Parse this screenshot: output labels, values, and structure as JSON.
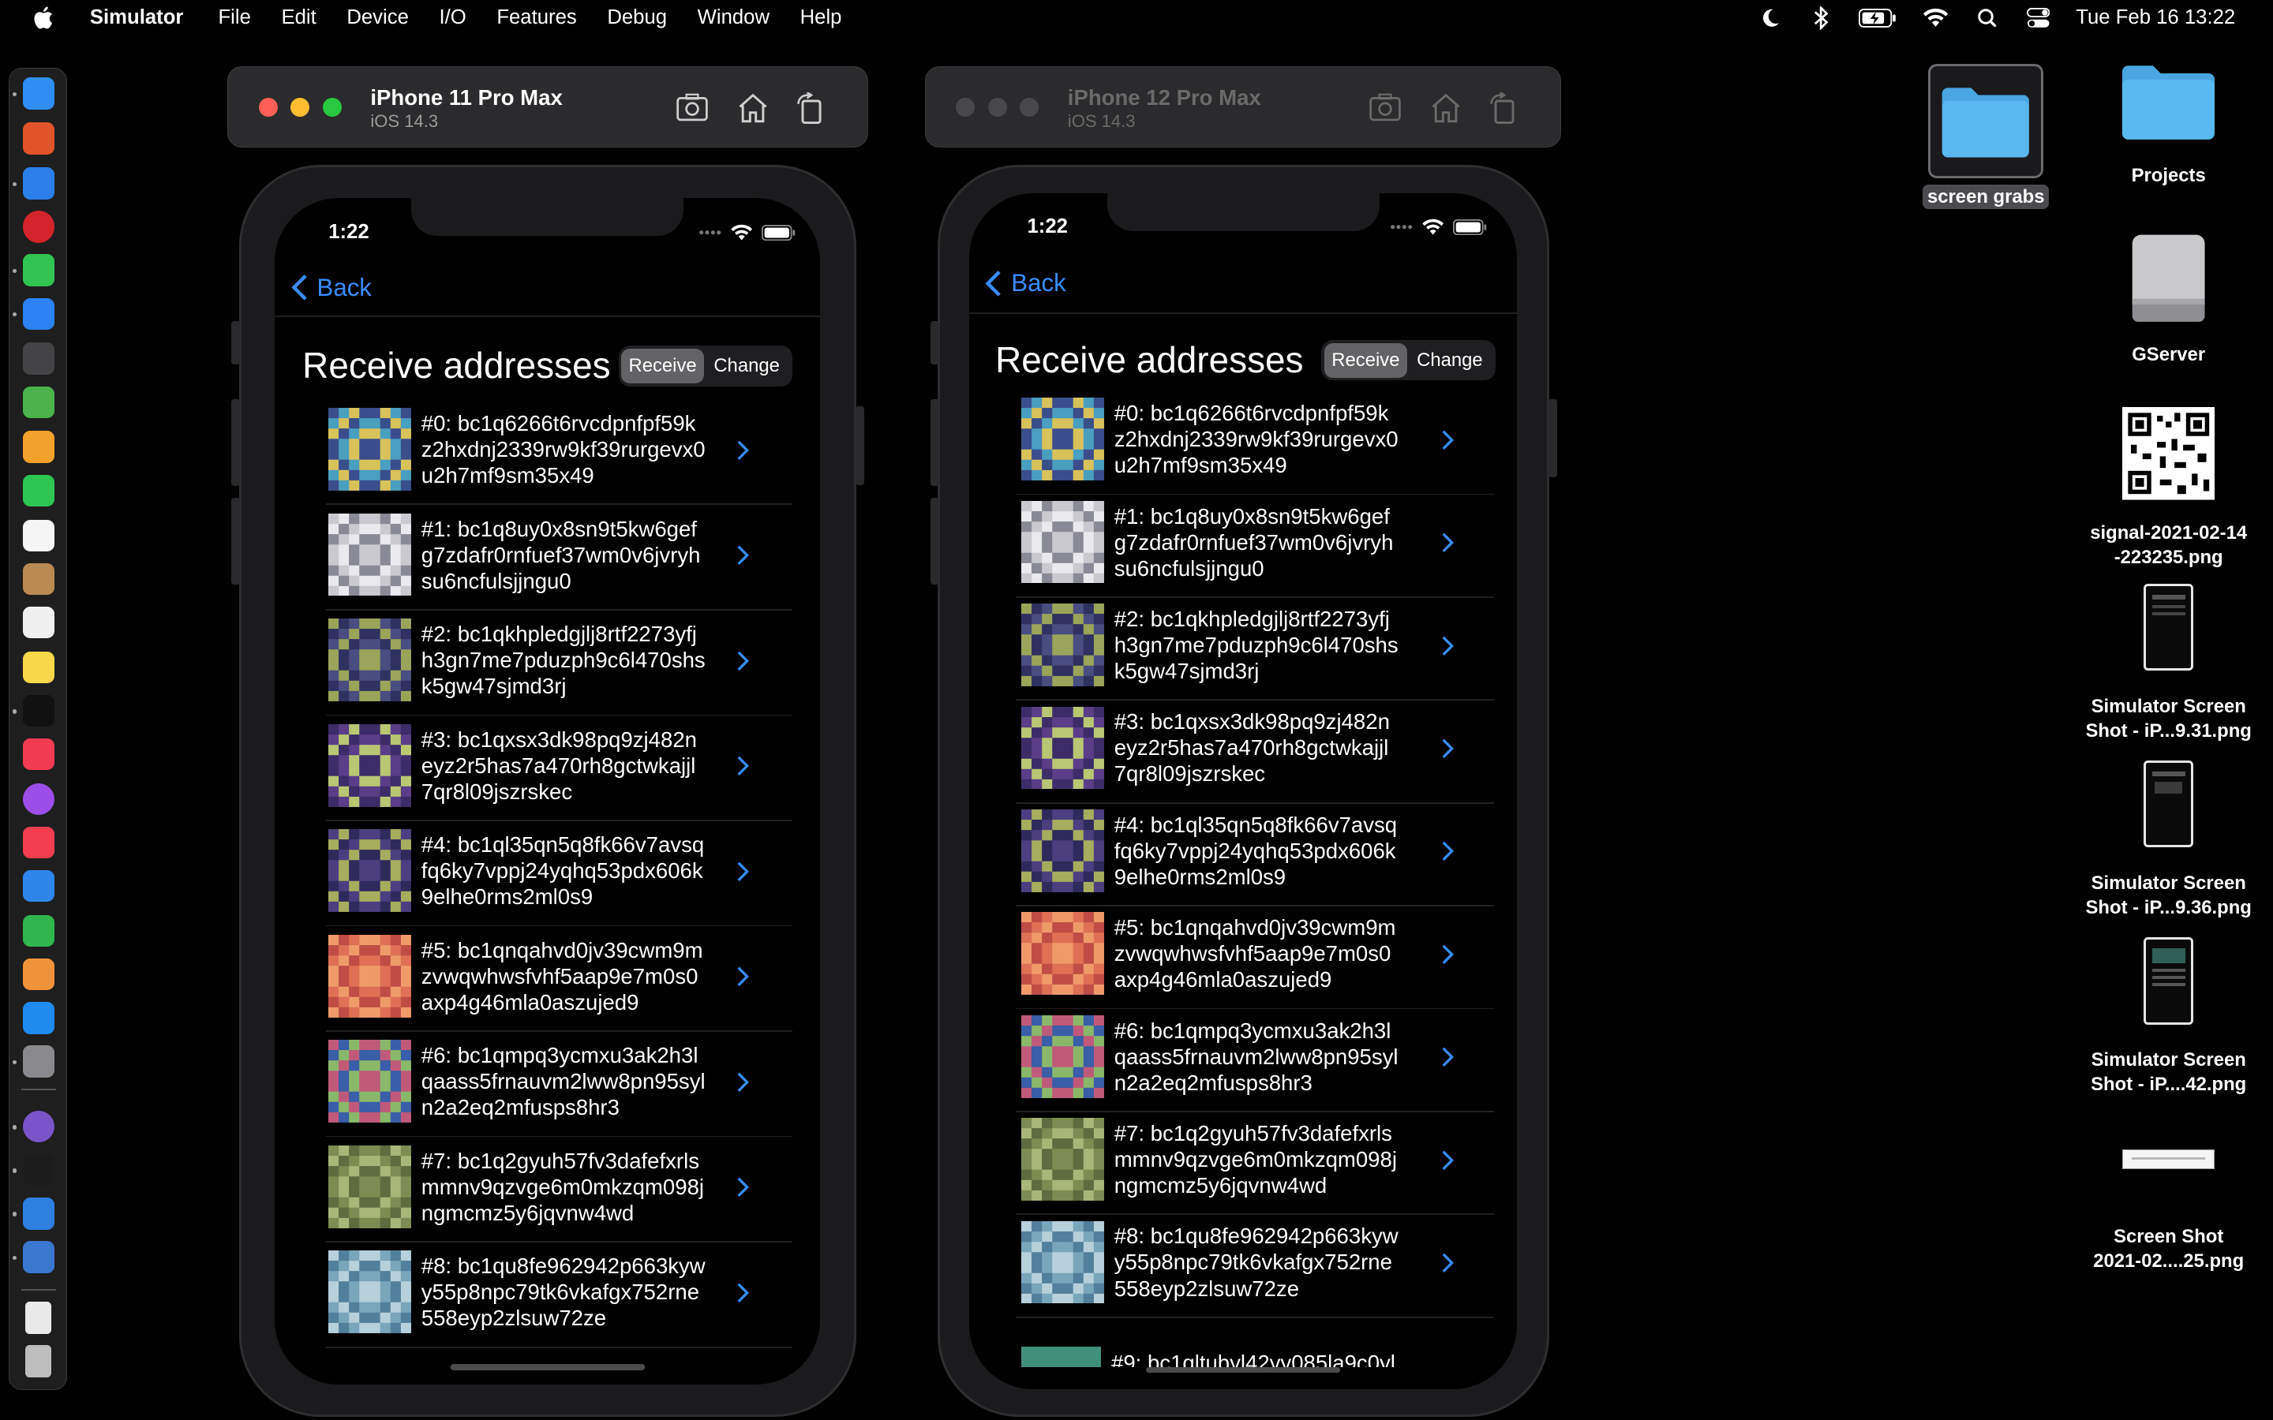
{
  "menubar": {
    "app_name": "Simulator",
    "items": [
      "File",
      "Edit",
      "Device",
      "I/O",
      "Features",
      "Debug",
      "Window",
      "Help"
    ],
    "clock": "Tue Feb 16  13:22"
  },
  "dock": {
    "icons": [
      {
        "name": "finder-icon",
        "color": "#2f8df5"
      },
      {
        "name": "launchpad-icon",
        "color": "#e0542a"
      },
      {
        "name": "safari-icon",
        "color": "#2a7fe8"
      },
      {
        "name": "opera-icon",
        "color": "#d4242b"
      },
      {
        "name": "messages-icon",
        "color": "#32c453"
      },
      {
        "name": "mail-icon",
        "color": "#2b82f0"
      },
      {
        "name": "circles-icon",
        "color": "#444446"
      },
      {
        "name": "maps-icon",
        "color": "#4bb24c"
      },
      {
        "name": "photos-icon",
        "color": "#f2a12c"
      },
      {
        "name": "facetime-icon",
        "color": "#2fc553"
      },
      {
        "name": "calendar-icon",
        "color": "#f5f5f5"
      },
      {
        "name": "app-brown-icon",
        "color": "#b98b52"
      },
      {
        "name": "reminders-icon",
        "color": "#f0f0f0"
      },
      {
        "name": "notes-icon",
        "color": "#f8d84b"
      },
      {
        "name": "apple-tv-icon",
        "color": "#111111"
      },
      {
        "name": "music-icon",
        "color": "#f23a52"
      },
      {
        "name": "podcasts-icon",
        "color": "#9b4ee8"
      },
      {
        "name": "news-icon",
        "color": "#f33c4f"
      },
      {
        "name": "keynote-icon",
        "color": "#2f86ea"
      },
      {
        "name": "numbers-icon",
        "color": "#31b54e"
      },
      {
        "name": "pages-icon",
        "color": "#f0923a"
      },
      {
        "name": "app-store-icon",
        "color": "#1f8af0"
      },
      {
        "name": "system-preferences-icon",
        "color": "#8a8a8e"
      },
      {
        "name": "github-icon",
        "color": "#7a55c9"
      },
      {
        "name": "terminal-icon",
        "color": "#1c1c1c"
      },
      {
        "name": "xcode-icon",
        "color": "#2d7fe0"
      },
      {
        "name": "xcode-tools-icon",
        "color": "#3a78d0"
      },
      {
        "name": "document-icon",
        "color": "#e9e9e9"
      },
      {
        "name": "trash-icon",
        "color": "#bdbdbd"
      }
    ]
  },
  "sim1": {
    "title": "iPhone 11 Pro Max",
    "subtitle": "iOS 14.3",
    "time": "1:22",
    "back": "Back",
    "heading": "Receive addresses",
    "seg_receive": "Receive",
    "seg_change": "Change",
    "rows": [
      {
        "text": "#0: bc1q6266t6rvcdpnfpf59kz2hxdnj2339rw9kf39rurgevx0u2h7mf9sm35x49",
        "c1": "#4a9fc0",
        "c2": "#d8c25a",
        "c3": "#3a4e8c"
      },
      {
        "text": "#1: bc1q8uy0x8sn9t5kw6gefg7zdafr0rnfuef37wm0v6jvryhsu6ncfulsjjngu0",
        "c1": "#c9c9cf",
        "c2": "#e9e9ee",
        "c3": "#8a8a96"
      },
      {
        "text": "#2: bc1qkhpledgjlj8rtf2273yfjh3gn7me7pduzph9c6l470shsk5gw47sjmd3rj",
        "c1": "#4a4d80",
        "c2": "#9aa45a",
        "c3": "#2f3160"
      },
      {
        "text": "#3: bc1qxsx3dk98pq9zj482neyz2r5has7a470rh8gctwkajjl7qr8l09jszrskec",
        "c1": "#5a3e88",
        "c2": "#b9c774",
        "c3": "#3c2c68"
      },
      {
        "text": "#4: bc1ql35qn5q8fk66v7avsqfq6ky7vppj24yqhq53pdx606k9elhe0rms2ml0s9",
        "c1": "#4c3f80",
        "c2": "#a6ad5e",
        "c3": "#2f2a5c"
      },
      {
        "text": "#5: bc1qnqahvd0jv39cwm9mzvwqwhwsfvhf5aap9e7m0s0axp4g46mla0aszujed9",
        "c1": "#e07055",
        "c2": "#f09a6a",
        "c3": "#c04d45"
      },
      {
        "text": "#6: bc1qmpq3ycmxu3ak2h3lqaass5frnauvm2lww8pn95syln2a2eq2mfusps8hr3",
        "c1": "#3a5ea8",
        "c2": "#8ab86a",
        "c3": "#c05a7a"
      },
      {
        "text": "#7: bc1q2gyuh57fv3dafefxrlsmmnv9qzvge6m0mkzqm098jngmcmz5y6jqvnw4wd",
        "c1": "#7c8c52",
        "c2": "#a9b67a",
        "c3": "#5e6c40"
      },
      {
        "text": "#8: bc1qu8fe962942p663kywy55p8npc79tk6vkafgx752rne558eyp2zlsuw72ze",
        "c1": "#7aa6bc",
        "c2": "#b6d0dc",
        "c3": "#52809c"
      }
    ]
  },
  "sim2": {
    "title": "iPhone 12 Pro Max",
    "subtitle": "iOS 14.3",
    "time": "1:22",
    "back": "Back",
    "heading": "Receive addresses",
    "seg_receive": "Receive",
    "seg_change": "Change",
    "partial_row": "#9: bc1qltubyl42yy085la9c0yl",
    "rows": [
      {
        "text": "#0: bc1q6266t6rvcdpnfpf59kz2hxdnj2339rw9kf39rurgevx0u2h7mf9sm35x49",
        "c1": "#4a9fc0",
        "c2": "#d8c25a",
        "c3": "#3a4e8c"
      },
      {
        "text": "#1: bc1q8uy0x8sn9t5kw6gefg7zdafr0rnfuef37wm0v6jvryhsu6ncfulsjjngu0",
        "c1": "#c9c9cf",
        "c2": "#e9e9ee",
        "c3": "#8a8a96"
      },
      {
        "text": "#2: bc1qkhpledgjlj8rtf2273yfjh3gn7me7pduzph9c6l470shsk5gw47sjmd3rj",
        "c1": "#4a4d80",
        "c2": "#9aa45a",
        "c3": "#2f3160"
      },
      {
        "text": "#3: bc1qxsx3dk98pq9zj482neyz2r5has7a470rh8gctwkajjl7qr8l09jszrskec",
        "c1": "#5a3e88",
        "c2": "#b9c774",
        "c3": "#3c2c68"
      },
      {
        "text": "#4: bc1ql35qn5q8fk66v7avsqfq6ky7vppj24yqhq53pdx606k9elhe0rms2ml0s9",
        "c1": "#4c3f80",
        "c2": "#a6ad5e",
        "c3": "#2f2a5c"
      },
      {
        "text": "#5: bc1qnqahvd0jv39cwm9mzvwqwhwsfvhf5aap9e7m0s0axp4g46mla0aszujed9",
        "c1": "#e07055",
        "c2": "#f09a6a",
        "c3": "#c04d45"
      },
      {
        "text": "#6: bc1qmpq3ycmxu3ak2h3lqaass5frnauvm2lww8pn95syln2a2eq2mfusps8hr3",
        "c1": "#3a5ea8",
        "c2": "#8ab86a",
        "c3": "#c05a7a"
      },
      {
        "text": "#7: bc1q2gyuh57fv3dafefxrlsmmnv9qzvge6m0mkzqm098jngmcmz5y6jqvnw4wd",
        "c1": "#7c8c52",
        "c2": "#a9b67a",
        "c3": "#5e6c40"
      },
      {
        "text": "#8: bc1qu8fe962942p663kywy55p8npc79tk6vkafgx752rne558eyp2zlsuw72ze",
        "c1": "#7aa6bc",
        "c2": "#b6d0dc",
        "c3": "#52809c"
      }
    ]
  },
  "desktop": {
    "screen_grabs": "screen grabs",
    "projects": "Projects",
    "gserver": "GServer",
    "signal_png": "signal-2021-02-14\n-223235.png",
    "shot1": "Simulator Screen\nShot - iP...9.31.png",
    "shot2": "Simulator Screen\nShot - iP...9.36.png",
    "shot3": "Simulator Screen\nShot - iP....42.png",
    "shot4": "Screen Shot\n2021-02....25.png"
  },
  "colors": {
    "accent_blue": "#3a8cff",
    "folder_blue": "#5ab8f0",
    "traffic_red": "#ff5f57",
    "traffic_yellow": "#febc2e",
    "traffic_green": "#28c840"
  }
}
